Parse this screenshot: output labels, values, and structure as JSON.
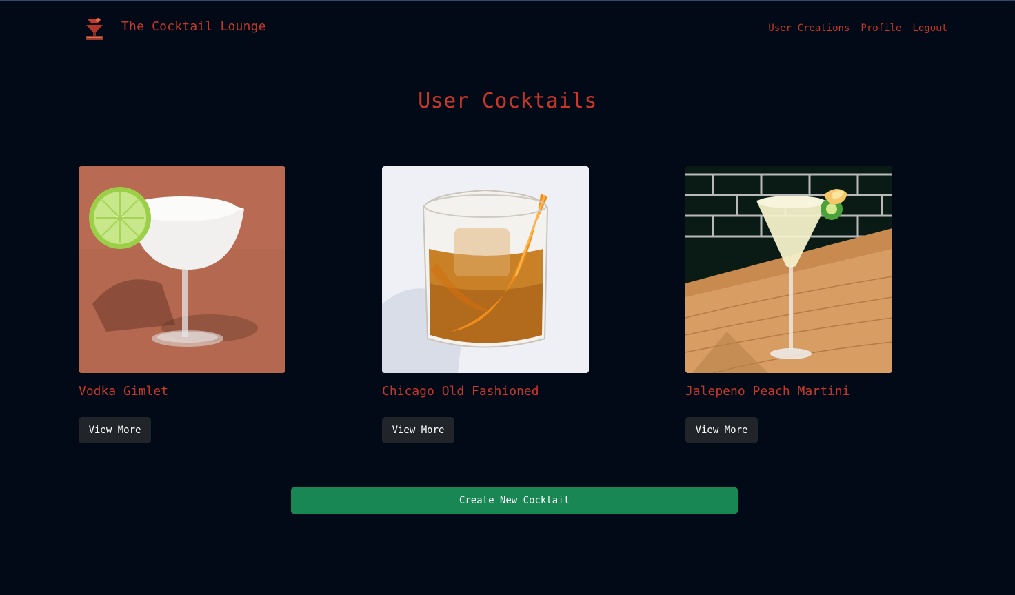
{
  "navbar": {
    "brand_title": "The Cocktail Lounge",
    "links": [
      "User Creations",
      "Profile",
      "Logout"
    ]
  },
  "main": {
    "title": "User Cocktails",
    "cards": [
      {
        "name": "Vodka Gimlet",
        "button": "View More",
        "photo_icon": "vodka-gimlet-photo"
      },
      {
        "name": "Chicago Old Fashioned",
        "button": "View More",
        "photo_icon": "old-fashioned-photo"
      },
      {
        "name": "Jalepeno Peach Martini",
        "button": "View More",
        "photo_icon": "martini-photo"
      }
    ],
    "create_button": "Create New Cocktail"
  },
  "colors": {
    "background": "#010a16",
    "accent": "#c7372b",
    "button_dark": "#212529",
    "button_green": "#198754"
  }
}
